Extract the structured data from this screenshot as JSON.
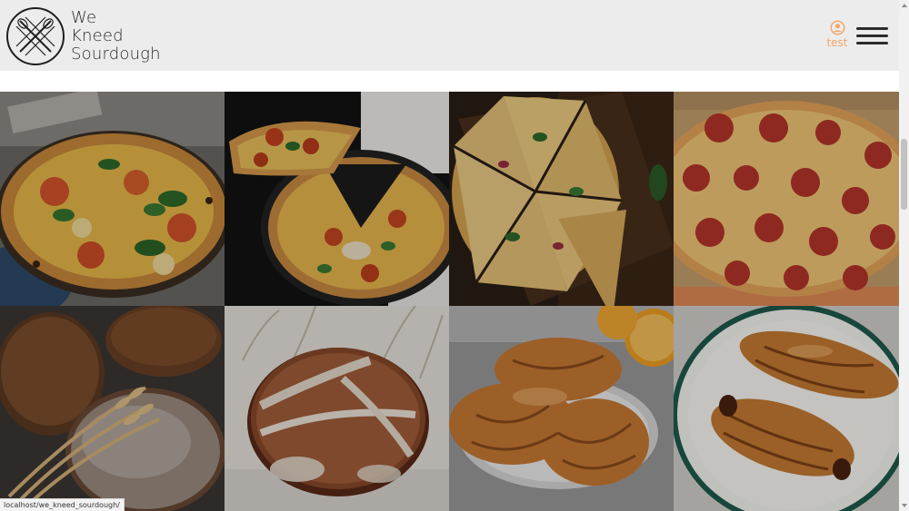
{
  "header": {
    "brand": {
      "logo_icon": "whisks-circle-logo",
      "line1": "We",
      "line2": "Kneed",
      "line3": "Sourdough"
    },
    "user": {
      "icon": "user-circle-icon",
      "label": "test",
      "color": "#f3a56b"
    },
    "menu_icon": "hamburger-menu-icon"
  },
  "gallery": {
    "images": [
      {
        "subject": "margherita-pizza"
      },
      {
        "subject": "pizza-in-pan-slice-lifted"
      },
      {
        "subject": "sliced-chicken-pizza-on-board"
      },
      {
        "subject": "pepperoni-pizza"
      },
      {
        "subject": "sourdough-loaves-with-wheat"
      },
      {
        "subject": "scored-sourdough-boule"
      },
      {
        "subject": "croissants-with-orange"
      },
      {
        "subject": "croissants-on-plate"
      }
    ]
  },
  "status_bar": {
    "url": "localhost/we_kneed_sourdough/"
  },
  "colors": {
    "header_bg": "#ececec",
    "accent": "#f3a56b",
    "text_dark": "#2b2b2b"
  }
}
